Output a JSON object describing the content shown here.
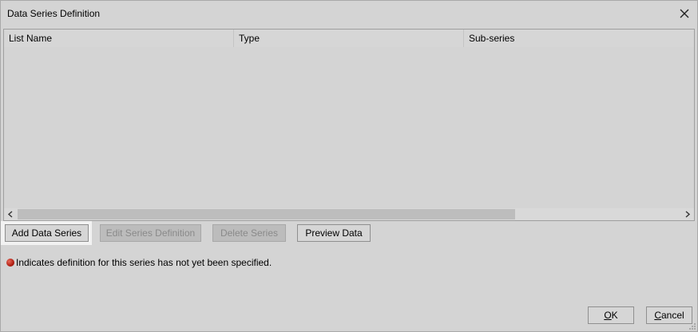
{
  "window": {
    "title": "Data Series Definition"
  },
  "grid": {
    "columns": [
      "List Name",
      "Type",
      "Sub-series"
    ]
  },
  "buttons": {
    "add_series": "Add Data Series",
    "edit_definition": "Edit Series Definition",
    "delete_series": "Delete Series",
    "preview_data": "Preview Data",
    "ok_mnemonic": "O",
    "ok_rest": "K",
    "cancel_mnemonic": "C",
    "cancel_rest": "ancel"
  },
  "legend": {
    "text": "Indicates definition for this series has not yet been specified.",
    "icon": "red-dot-icon",
    "color": "#b01e12"
  },
  "icons": {
    "close": "close-icon",
    "scroll_left": "chevron-left-icon",
    "scroll_right": "chevron-right-icon",
    "grip": "resize-grip-icon"
  }
}
